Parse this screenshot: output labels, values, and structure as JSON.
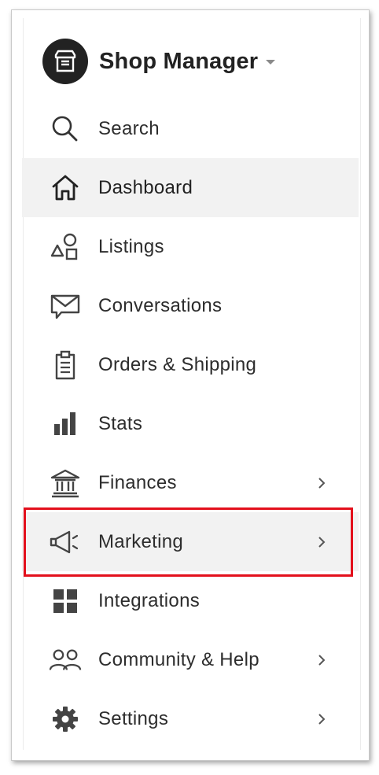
{
  "header": {
    "title": "Shop Manager",
    "icon": "storefront-icon"
  },
  "nav": {
    "items": [
      {
        "label": "Search",
        "icon": "search-icon"
      },
      {
        "label": "Dashboard",
        "icon": "home-icon"
      },
      {
        "label": "Listings",
        "icon": "shapes-icon"
      },
      {
        "label": "Conversations",
        "icon": "envelope-icon"
      },
      {
        "label": "Orders & Shipping",
        "icon": "clipboard-icon"
      },
      {
        "label": "Stats",
        "icon": "bar-chart-icon"
      },
      {
        "label": "Finances",
        "icon": "bank-icon"
      },
      {
        "label": "Marketing",
        "icon": "megaphone-icon"
      },
      {
        "label": "Integrations",
        "icon": "grid-icon"
      },
      {
        "label": "Community & Help",
        "icon": "people-icon"
      },
      {
        "label": "Settings",
        "icon": "gear-icon"
      }
    ]
  },
  "colors": {
    "highlight": "#e3101c",
    "active_bg": "#f2f2f2",
    "text": "#2d2d2d"
  }
}
